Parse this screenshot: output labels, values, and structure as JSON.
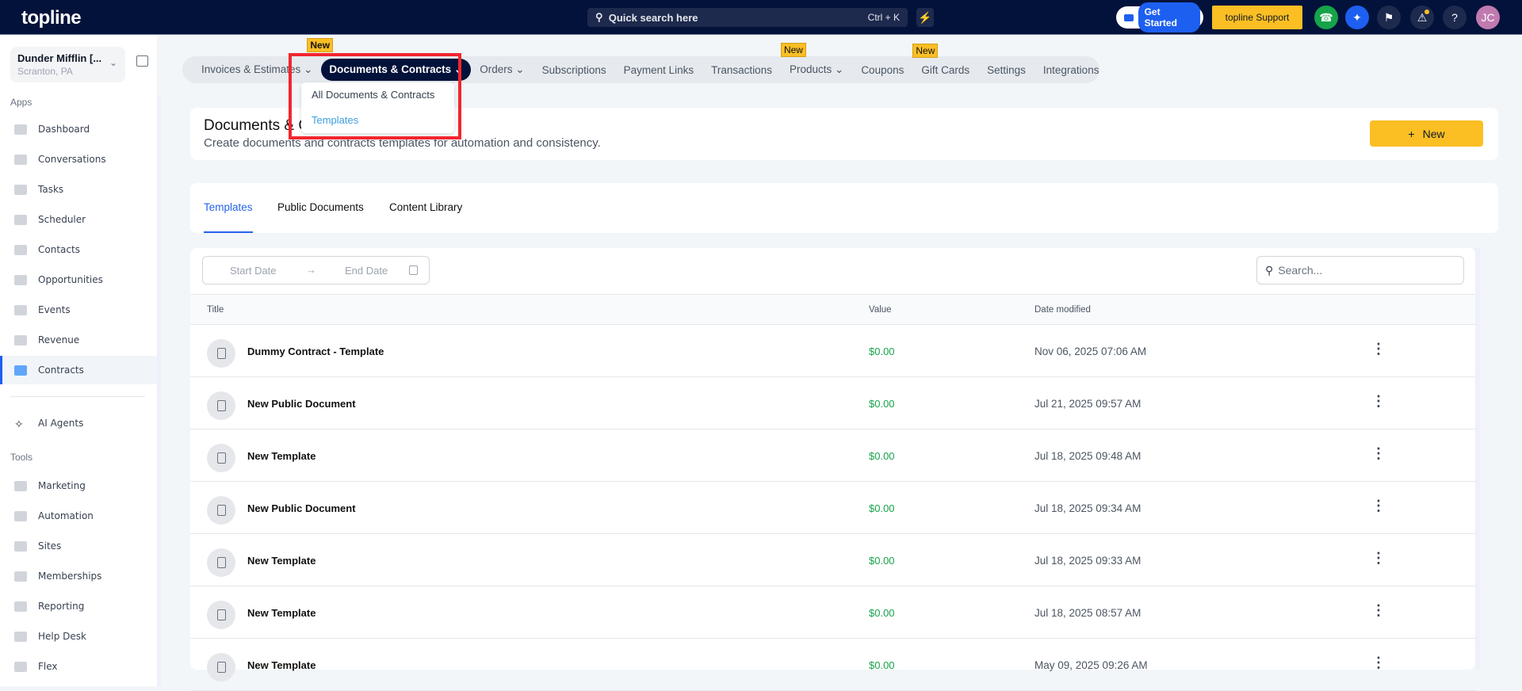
{
  "topbar": {
    "logo": "topline",
    "search_placeholder": "Quick search here",
    "search_shortcut": "Ctrl + K",
    "get_started": "Get Started",
    "support": "topline Support",
    "avatar": "JC"
  },
  "account": {
    "name": "Dunder Mifflin [...",
    "location": "Scranton, PA"
  },
  "sidebar": {
    "apps_label": "Apps",
    "tools_label": "Tools",
    "apps": [
      {
        "label": "Dashboard"
      },
      {
        "label": "Conversations"
      },
      {
        "label": "Tasks"
      },
      {
        "label": "Scheduler"
      },
      {
        "label": "Contacts"
      },
      {
        "label": "Opportunities"
      },
      {
        "label": "Events"
      },
      {
        "label": "Revenue"
      },
      {
        "label": "Contracts",
        "active": true
      }
    ],
    "ai": {
      "label": "AI Agents"
    },
    "tools": [
      {
        "label": "Marketing"
      },
      {
        "label": "Automation"
      },
      {
        "label": "Sites"
      },
      {
        "label": "Memberships"
      },
      {
        "label": "Reporting"
      },
      {
        "label": "Help Desk"
      },
      {
        "label": "Flex"
      }
    ]
  },
  "nav": {
    "badge": "New",
    "items": [
      {
        "label": "Invoices & Estimates",
        "chevron": true
      },
      {
        "label": "Documents & Contracts",
        "chevron": true,
        "selected": true,
        "badge": true
      },
      {
        "label": "Orders",
        "chevron": true
      },
      {
        "label": "Subscriptions"
      },
      {
        "label": "Payment Links"
      },
      {
        "label": "Transactions"
      },
      {
        "label": "Products",
        "chevron": true,
        "badge": true
      },
      {
        "label": "Coupons"
      },
      {
        "label": "Gift Cards",
        "badge": true
      },
      {
        "label": "Settings"
      },
      {
        "label": "Integrations"
      }
    ]
  },
  "dropdown": {
    "items": [
      "All Documents & Contracts",
      "Templates"
    ]
  },
  "header": {
    "title": "Documents & Contracts",
    "subtitle": "Create documents and contracts templates for automation and consistency.",
    "new_button": "New"
  },
  "tabs": [
    "Templates",
    "Public Documents",
    "Content Library"
  ],
  "filters": {
    "start_date": "Start Date",
    "end_date": "End Date",
    "search_placeholder": "Search..."
  },
  "table": {
    "columns": [
      "Title",
      "Value",
      "Date modified"
    ],
    "rows": [
      {
        "title": "Dummy Contract - Template",
        "value": "$0.00",
        "date": "Nov 06, 2025 07:06 AM"
      },
      {
        "title": "New Public Document",
        "value": "$0.00",
        "date": "Jul 21, 2025 09:57 AM"
      },
      {
        "title": "New Template",
        "value": "$0.00",
        "date": "Jul 18, 2025 09:48 AM"
      },
      {
        "title": "New Public Document",
        "value": "$0.00",
        "date": "Jul 18, 2025 09:34 AM"
      },
      {
        "title": "New Template",
        "value": "$0.00",
        "date": "Jul 18, 2025 09:33 AM"
      },
      {
        "title": "New Template",
        "value": "$0.00",
        "date": "Jul 18, 2025 08:57 AM"
      },
      {
        "title": "New Template",
        "value": "$0.00",
        "date": "May 09, 2025 09:26 AM"
      }
    ]
  },
  "colors": {
    "topbar": "#03123a",
    "accent": "#fbbf24",
    "primary": "#2563eb",
    "value_green": "#16a34a",
    "highlight": "#f2262f"
  }
}
